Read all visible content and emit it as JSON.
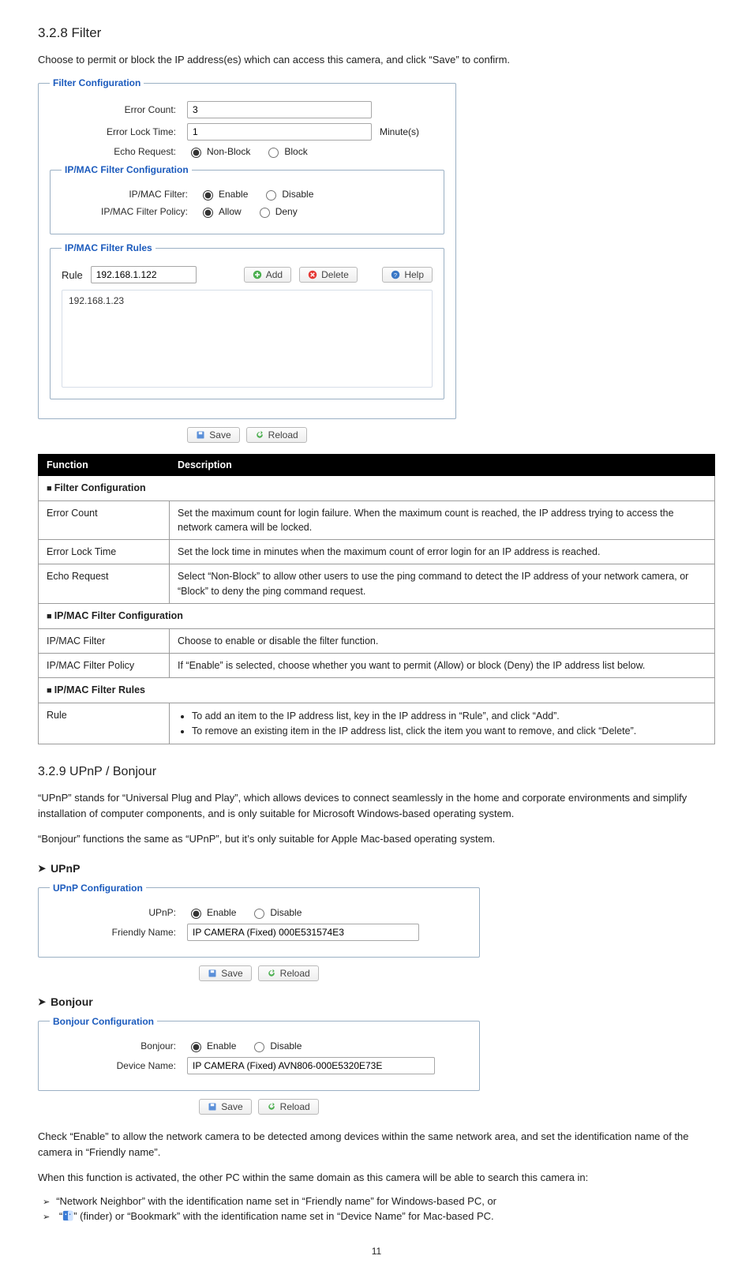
{
  "section_filter": {
    "title": "3.2.8 Filter",
    "intro": "Choose to permit or block the IP address(es) which can access this camera, and click “Save” to confirm."
  },
  "filter_conf": {
    "legend": "Filter Configuration",
    "error_count_label": "Error Count:",
    "error_count_value": "3",
    "error_lock_label": "Error Lock Time:",
    "error_lock_value": "1",
    "error_lock_unit": "Minute(s)",
    "echo_label": "Echo Request:",
    "echo_nonblock": "Non-Block",
    "echo_block": "Block"
  },
  "ipmac_conf": {
    "legend": "IP/MAC Filter Configuration",
    "filter_label": "IP/MAC Filter:",
    "enable": "Enable",
    "disable": "Disable",
    "policy_label": "IP/MAC Filter Policy:",
    "allow": "Allow",
    "deny": "Deny"
  },
  "ipmac_rules": {
    "legend": "IP/MAC Filter Rules",
    "rule_label": "Rule",
    "rule_value": "192.168.1.122",
    "add": "Add",
    "delete": "Delete",
    "help": "Help",
    "listed_rule": "192.168.1.23"
  },
  "common": {
    "save": "Save",
    "reload": "Reload"
  },
  "table": {
    "h1": "Function",
    "h2": "Description",
    "sect1": "Filter Configuration",
    "r1f": "Error Count",
    "r1d": "Set the maximum count for login failure. When the maximum count is reached, the IP address trying to access the network camera will be locked.",
    "r2f": "Error Lock Time",
    "r2d": "Set the lock time in minutes when the maximum count of error login for an IP address is reached.",
    "r3f": "Echo Request",
    "r3d": "Select “Non-Block” to allow other users to use the ping command to detect the IP address of your network camera, or “Block” to deny the ping command request.",
    "sect2": "IP/MAC Filter Configuration",
    "r4f": "IP/MAC Filter",
    "r4d": "Choose to enable or disable the filter function.",
    "r5f": "IP/MAC Filter Policy",
    "r5d": "If “Enable” is selected, choose whether you want to permit (Allow) or block (Deny) the IP address list below.",
    "sect3": "IP/MAC Filter Rules",
    "r6f": "Rule",
    "r6b1": "To add an item to the IP address list, key in the IP address in “Rule”, and click “Add”.",
    "r6b2": "To remove an existing item in the IP address list, click the item you want to remove, and click “Delete”."
  },
  "upnp_sec": {
    "title": "3.2.9 UPnP / Bonjour",
    "p1": "“UPnP” stands for “Universal Plug and Play”, which allows devices to connect seamlessly in the home and corporate environments and simplify installation of computer components, and is only suitable for Microsoft Windows-based operating system.",
    "p2": "“Bonjour” functions the same as “UPnP”, but it’s only suitable for Apple Mac-based operating system.",
    "sub_upnp": "UPnP",
    "sub_bonjour": "Bonjour"
  },
  "upnp_conf": {
    "legend": "UPnP Configuration",
    "upnp_label": "UPnP:",
    "friendly_label": "Friendly Name:",
    "friendly_value": "IP CAMERA (Fixed) 000E531574E3"
  },
  "bonjour_conf": {
    "legend": "Bonjour Configuration",
    "bonjour_label": "Bonjour:",
    "device_label": "Device Name:",
    "device_value": "IP CAMERA (Fixed) AVN806-000E5320E73E"
  },
  "trail": {
    "p3": "Check “Enable” to allow the network camera to be detected among devices within the same network area, and set the identification name of the camera in “Friendly name”.",
    "p4": "When this function is activated, the other PC within the same domain as this camera will be able to search this camera in:",
    "b1": "“Network Neighbor” with the identification name set in “Friendly name” for Windows-based PC, or",
    "b2_a": "“",
    "b2_b": "” (finder) or “Bookmark” with the identification name set in “Device Name” for Mac-based PC."
  },
  "page": "11"
}
